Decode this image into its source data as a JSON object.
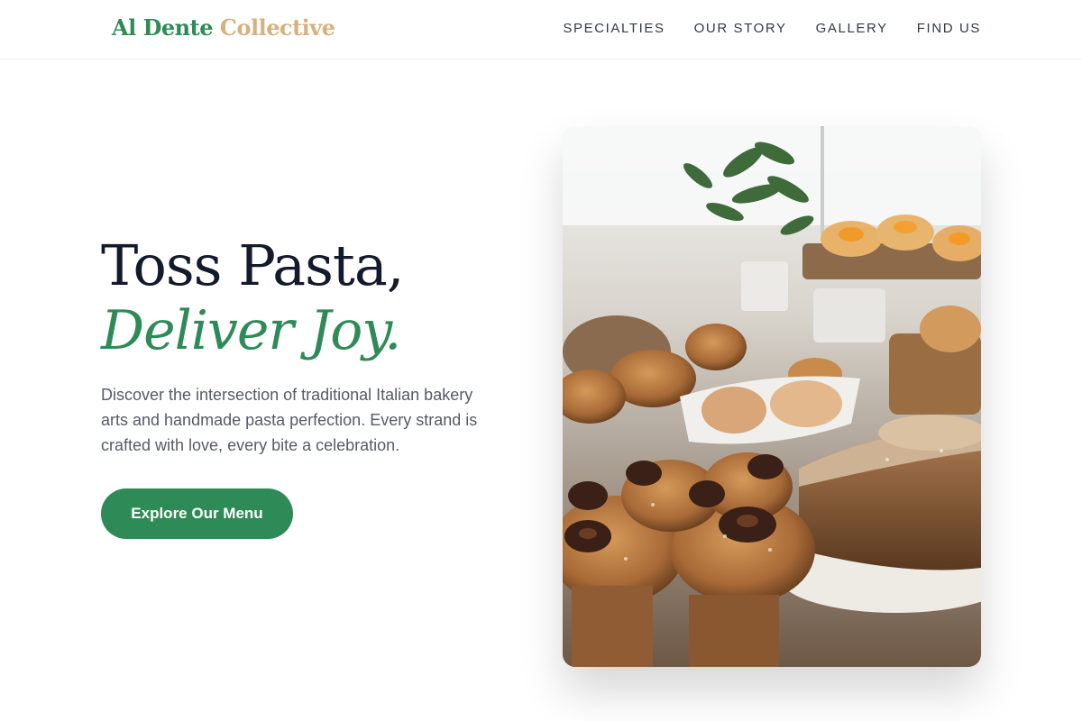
{
  "header": {
    "logo_part1": "Al Dente",
    "logo_part2": "Collective",
    "nav": [
      "SPECIALTIES",
      "OUR STORY",
      "GALLERY",
      "FIND US"
    ]
  },
  "hero": {
    "headline_line1": "Toss Pasta,",
    "headline_line2": "Deliver Joy.",
    "description": "Discover the intersection of traditional Italian bakery arts and handmade pasta perfection. Every strand is crafted with love, every bite a celebration.",
    "cta_label": "Explore Our Menu"
  },
  "colors": {
    "brand_green": "#2e8b57",
    "brand_gold": "#d7b07e",
    "heading_dark": "#141a2e"
  }
}
